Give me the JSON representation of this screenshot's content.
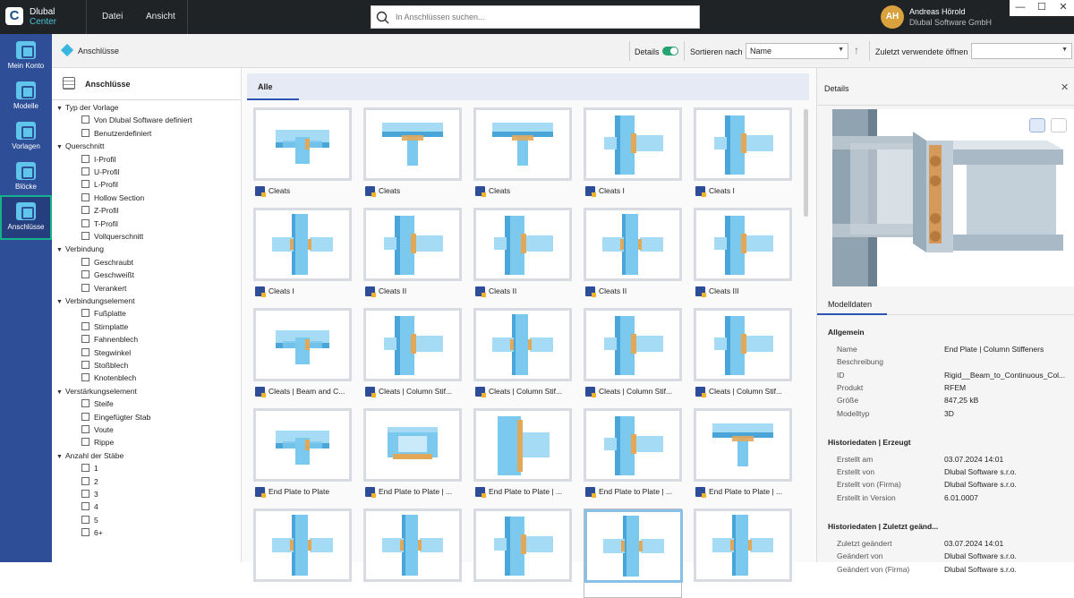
{
  "app": {
    "name": "Dlubal",
    "subname": "Center"
  },
  "menu": [
    "Datei",
    "Ansicht"
  ],
  "search": {
    "placeholder": "In Anschlüssen suchen..."
  },
  "user": {
    "initials": "AH",
    "name": "Andreas Hörold",
    "company": "Dlubal Software GmbH"
  },
  "window_controls": [
    "—",
    "☐",
    "✕"
  ],
  "nav": [
    {
      "label": "Mein Konto",
      "active": false
    },
    {
      "label": "Modelle",
      "active": false
    },
    {
      "label": "Vorlagen",
      "active": false
    },
    {
      "label": "Blöcke",
      "active": false
    },
    {
      "label": "Anschlüsse",
      "active": true
    }
  ],
  "toolbar": {
    "title": "Anschlüsse",
    "details_label": "Details",
    "details_on": true,
    "sort_label": "Sortieren nach",
    "sort_value": "Name",
    "recent_label": "Zuletzt verwendete öffnen",
    "recent_value": ""
  },
  "filters": {
    "title": "Anschlüsse",
    "rows": [
      {
        "type": "cat",
        "label": "Typ der Vorlage"
      },
      {
        "type": "opt",
        "label": "Von Dlubal Software definiert"
      },
      {
        "type": "opt",
        "label": "Benutzerdefiniert"
      },
      {
        "type": "cat",
        "label": "Querschnitt"
      },
      {
        "type": "opt",
        "label": "I-Profil"
      },
      {
        "type": "opt",
        "label": "U-Profil"
      },
      {
        "type": "opt",
        "label": "L-Profil"
      },
      {
        "type": "opt",
        "label": "Hollow Section"
      },
      {
        "type": "opt",
        "label": "Z-Profil"
      },
      {
        "type": "opt",
        "label": "T-Profil"
      },
      {
        "type": "opt",
        "label": "Vollquerschnitt"
      },
      {
        "type": "cat",
        "label": "Verbindung"
      },
      {
        "type": "opt",
        "label": "Geschraubt"
      },
      {
        "type": "opt",
        "label": "Geschweißt"
      },
      {
        "type": "opt",
        "label": "Verankert"
      },
      {
        "type": "cat",
        "label": "Verbindungselement"
      },
      {
        "type": "opt",
        "label": "Fußplatte"
      },
      {
        "type": "opt",
        "label": "Stirnplatte"
      },
      {
        "type": "opt",
        "label": "Fahnenblech"
      },
      {
        "type": "opt",
        "label": "Stegwinkel"
      },
      {
        "type": "opt",
        "label": "Stoßblech"
      },
      {
        "type": "opt",
        "label": "Knotenblech"
      },
      {
        "type": "cat",
        "label": "Verstärkungselement"
      },
      {
        "type": "opt",
        "label": "Steife"
      },
      {
        "type": "opt",
        "label": "Eingefügter Stab"
      },
      {
        "type": "opt",
        "label": "Voute"
      },
      {
        "type": "opt",
        "label": "Rippe"
      },
      {
        "type": "cat",
        "label": "Anzahl der Stäbe"
      },
      {
        "type": "opt",
        "label": "1"
      },
      {
        "type": "opt",
        "label": "2"
      },
      {
        "type": "opt",
        "label": "3"
      },
      {
        "type": "opt",
        "label": "4"
      },
      {
        "type": "opt",
        "label": "5"
      },
      {
        "type": "opt",
        "label": "6+"
      }
    ]
  },
  "gallery": {
    "tab": "Alle",
    "cards": [
      {
        "label": "Cleats",
        "kind": "a"
      },
      {
        "label": "Cleats",
        "kind": "b"
      },
      {
        "label": "Cleats",
        "kind": "b"
      },
      {
        "label": "Cleats I",
        "kind": "c"
      },
      {
        "label": "Cleats I",
        "kind": "c"
      },
      {
        "label": "Cleats I",
        "kind": "d"
      },
      {
        "label": "Cleats II",
        "kind": "c"
      },
      {
        "label": "Cleats II",
        "kind": "c"
      },
      {
        "label": "Cleats II",
        "kind": "d"
      },
      {
        "label": "Cleats III",
        "kind": "c"
      },
      {
        "label": "Cleats | Beam and C...",
        "kind": "a"
      },
      {
        "label": "Cleats | Column Stif...",
        "kind": "c"
      },
      {
        "label": "Cleats | Column Stif...",
        "kind": "d"
      },
      {
        "label": "Cleats | Column Stif...",
        "kind": "c"
      },
      {
        "label": "Cleats | Column Stif...",
        "kind": "c"
      },
      {
        "label": "End Plate to Plate",
        "kind": "a"
      },
      {
        "label": "End Plate to Plate | ...",
        "kind": "e"
      },
      {
        "label": "End Plate to Plate | ...",
        "kind": "f"
      },
      {
        "label": "End Plate to Plate | ...",
        "kind": "c"
      },
      {
        "label": "End Plate to Plate | ...",
        "kind": "b"
      },
      {
        "label": "",
        "kind": "d"
      },
      {
        "label": "",
        "kind": "d"
      },
      {
        "label": "",
        "kind": "c"
      },
      {
        "label": "",
        "kind": "d",
        "selected": true
      },
      {
        "label": "",
        "kind": "d"
      }
    ]
  },
  "details": {
    "title": "Details",
    "close": "✕",
    "tab": "Modelldaten",
    "sections": [
      {
        "title": "Allgemein",
        "rows": [
          {
            "k": "Name",
            "v": "End Plate | Column Stiffeners"
          },
          {
            "k": "Beschreibung",
            "v": ""
          },
          {
            "k": "ID",
            "v": "Rigid__Beam_to_Continuous_Col..."
          },
          {
            "k": "Produkt",
            "v": "RFEM"
          },
          {
            "k": "Größe",
            "v": "847,25 kB"
          },
          {
            "k": "Modelltyp",
            "v": "3D"
          }
        ]
      },
      {
        "title": "Historiedaten | Erzeugt",
        "rows": [
          {
            "k": "Erstellt am",
            "v": "03.07.2024 14:01"
          },
          {
            "k": "Erstellt von",
            "v": "Dlubal Software s.r.o."
          },
          {
            "k": "Erstellt von (Firma)",
            "v": "Dlubal Software s.r.o."
          },
          {
            "k": "Erstellt in Version",
            "v": "6.01.0007"
          }
        ]
      },
      {
        "title": "Historiedaten | Zuletzt geänd...",
        "rows": [
          {
            "k": "Zuletzt geändert",
            "v": "03.07.2024 14:01"
          },
          {
            "k": "Geändert von",
            "v": "Dlubal Software s.r.o."
          },
          {
            "k": "Geändert von (Firma)",
            "v": "Dlubal Software s.r.o."
          }
        ]
      }
    ]
  },
  "colors": {
    "nav_bg": "#2e4f98",
    "accent": "#2a55b0",
    "steel": "#74c6ee",
    "bolt": "#e2a85a",
    "active_outline": "#17b28c"
  }
}
